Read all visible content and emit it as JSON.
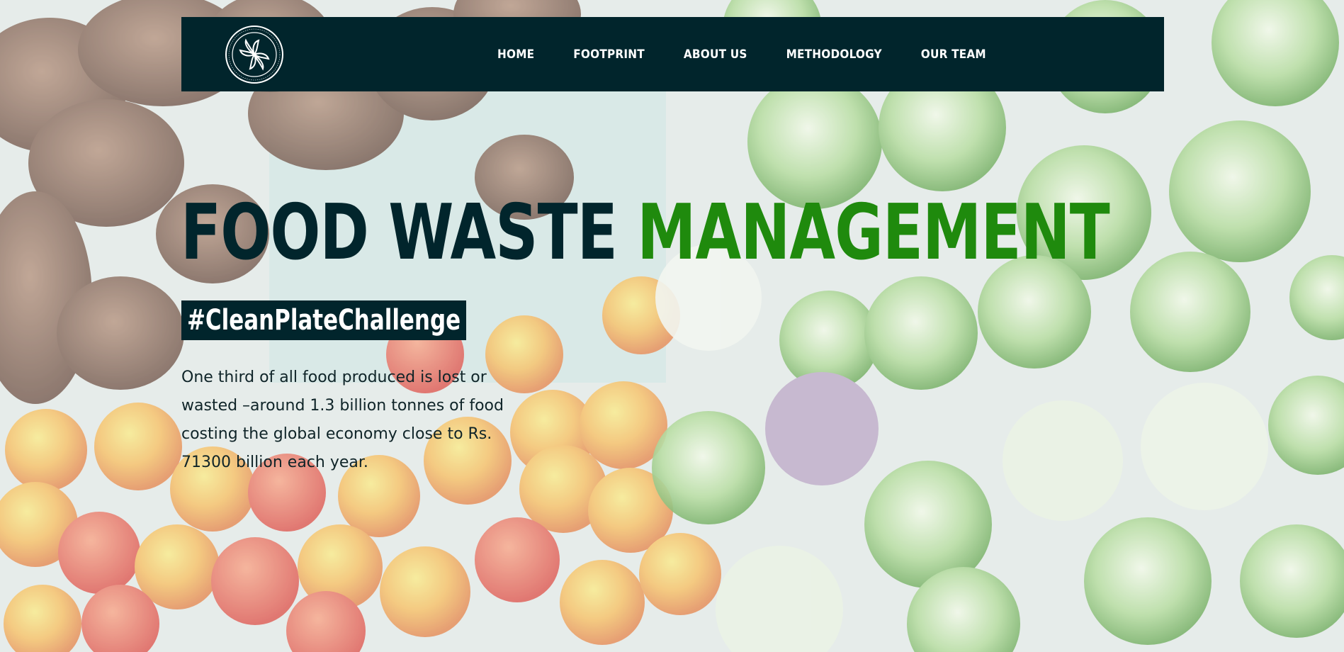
{
  "nav": {
    "logo_icon": "institute-seal-logo",
    "links": [
      "HOME",
      "FOOTPRINT",
      "ABOUT US",
      "METHODOLOGY",
      "OUR TEAM"
    ]
  },
  "hero": {
    "title_dark": "FOOD WASTE",
    "title_green": "MANAGEMENT",
    "hashtag": "#CleanPlateChallenge",
    "description": "One third of all food produced is lost or wasted –around 1.3 billion tonnes of food costing the global economy close to Rs. 71300 billion each year."
  },
  "colors": {
    "navbar_bg": "#01252c",
    "title_dark": "#01252c",
    "title_green": "#1f8a0d",
    "text": "#0f2428"
  }
}
